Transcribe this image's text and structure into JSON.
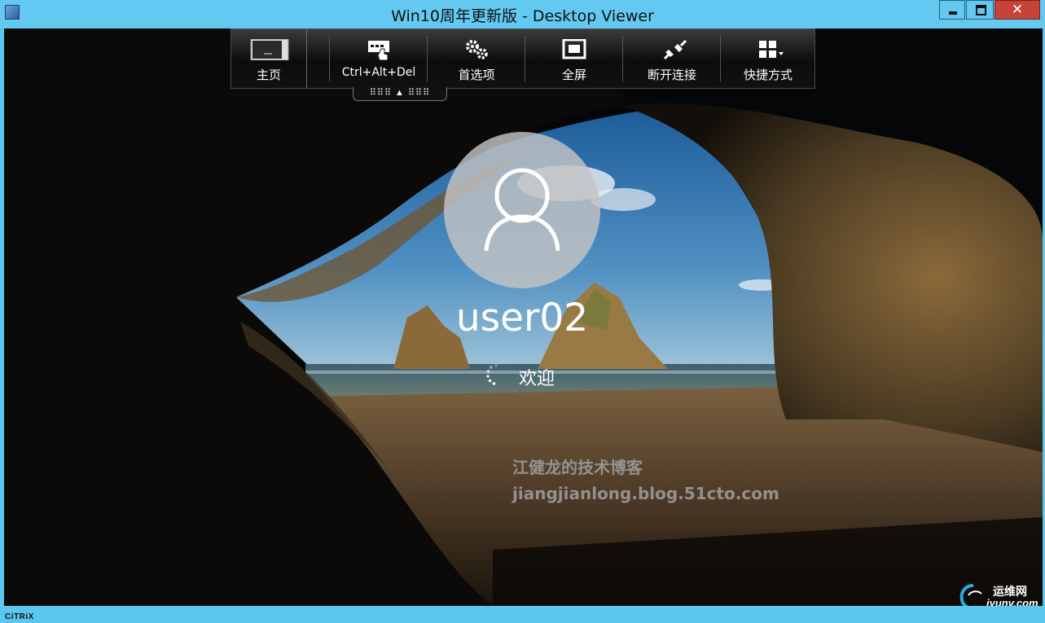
{
  "window": {
    "title": "Win10周年更新版 - Desktop Viewer",
    "controls": {
      "minimize_icon": "minimize-icon",
      "maximize_icon": "maximize-icon",
      "close_glyph": "✕"
    }
  },
  "toolbar": {
    "items": [
      {
        "label": "主页",
        "icon": "home-thumbnail-icon"
      },
      {
        "label": "Ctrl+Alt+Del",
        "icon": "keyboard-hand-icon"
      },
      {
        "label": "首选项",
        "icon": "gears-icon"
      },
      {
        "label": "全屏",
        "icon": "fullscreen-icon"
      },
      {
        "label": "断开连接",
        "icon": "plug-disconnect-icon"
      },
      {
        "label": "快捷方式",
        "icon": "shortcuts-grid-icon"
      }
    ],
    "pull_tab": "⠿⠿⠿ ▲ ⠿⠿⠿"
  },
  "lockscreen": {
    "username": "user02",
    "status": "欢迎",
    "avatar_icon": "user-icon",
    "spinner_icon": "loading-spinner-icon"
  },
  "watermark": {
    "line1": "江健龙的技术博客",
    "line2": "jiangjianlong.blog.51cto.com"
  },
  "corner_logo": {
    "name": "运维网",
    "url_text": "iyunv.com"
  },
  "footer": {
    "brand": "CiTRiX"
  },
  "colors": {
    "frame": "#63c9f0",
    "close": "#c7433a",
    "toolbar": "#111111",
    "accent_text": "#ffffff"
  }
}
